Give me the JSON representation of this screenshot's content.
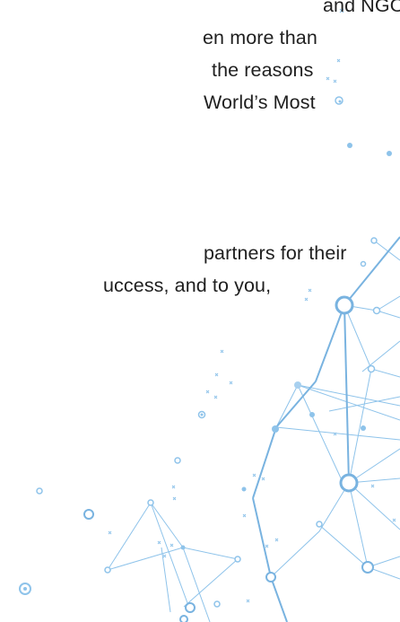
{
  "document": {
    "paragraph_1": [
      "and NGOs, has",
      "en more than",
      "the reasons",
      "World’s Most"
    ],
    "paragraph_2": [
      "partners for their",
      "uccess, and to you,"
    ]
  },
  "decoration": {
    "icon": "network-constellation-icon",
    "line_color": "#8ec3ea",
    "node_color": "#79b3e0",
    "accent_color": "#a8d0ef"
  }
}
